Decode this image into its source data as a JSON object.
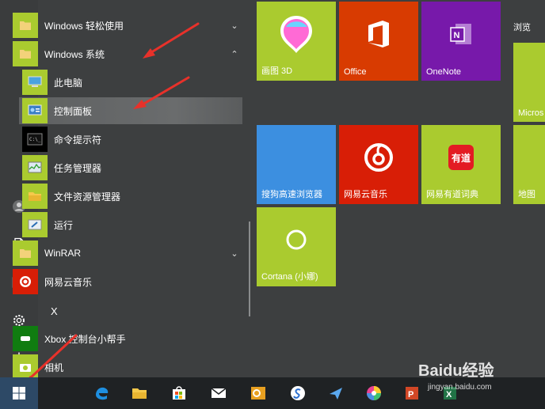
{
  "start_menu": {
    "apps": [
      {
        "label": "Windows 轻松使用",
        "chevron": "⌄",
        "icon": "folder-icon"
      },
      {
        "label": "Windows 系统",
        "chevron": "⌃",
        "icon": "folder-icon"
      },
      {
        "label": "此电脑",
        "icon": "computer-icon"
      },
      {
        "label": "控制面板",
        "icon": "control-panel-icon"
      },
      {
        "label": "命令提示符",
        "icon": "cmd-icon"
      },
      {
        "label": "任务管理器",
        "icon": "task-manager-icon"
      },
      {
        "label": "文件资源管理器",
        "icon": "file-explorer-icon"
      },
      {
        "label": "运行",
        "icon": "run-icon"
      },
      {
        "label": "WinRAR",
        "chevron": "⌄",
        "icon": "folder-icon"
      },
      {
        "label": "网易云音乐",
        "icon": "netease-music-icon"
      },
      {
        "label": "Xbox 控制台小帮手",
        "icon": "xbox-icon"
      },
      {
        "label": "相机",
        "icon": "camera-icon"
      }
    ],
    "letter_x": "X"
  },
  "tiles": {
    "section_label": "浏览",
    "items": [
      {
        "label": "画图 3D",
        "color": "#aacb2f"
      },
      {
        "label": "Office",
        "color": "#d83b01"
      },
      {
        "label": "OneNote",
        "color": "#7719aa"
      },
      {
        "label": "Micros",
        "color": "#aacb2f"
      },
      {
        "label": "搜狗高速浏览器",
        "color": "#3c8fe0"
      },
      {
        "label": "网易云音乐",
        "color": "#d81e06"
      },
      {
        "label": "网易有道词典",
        "color": "#aacb2f"
      },
      {
        "label": "地图",
        "color": "#aacb2f"
      },
      {
        "label": "Cortana (小娜)",
        "color": "#aacb2f"
      }
    ]
  },
  "taskbar": {
    "items": [
      "start-icon",
      "edge-icon",
      "file-explorer-icon",
      "store-icon",
      "mail-icon",
      "outlook-icon",
      "sogou-icon",
      "feishu-icon",
      "browser-icon",
      "powerpoint-icon",
      "excel-icon"
    ]
  },
  "watermark": {
    "brand": "Baidu经验",
    "url": "jingyan.baidu.com"
  },
  "colors": {
    "accent": "#aacb2f",
    "bg": "#3d3f40",
    "taskbar": "#1f2224"
  }
}
